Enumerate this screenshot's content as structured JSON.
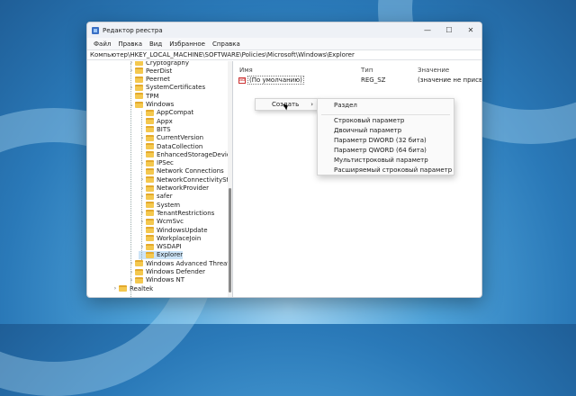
{
  "window": {
    "title": "Редактор реестра",
    "minimize": "—",
    "maximize": "☐",
    "close": "✕"
  },
  "menu": [
    "Файл",
    "Правка",
    "Вид",
    "Избранное",
    "Справка"
  ],
  "address": "Компьютер\\HKEY_LOCAL_MACHINE\\SOFTWARE\\Policies\\Microsoft\\Windows\\Explorer",
  "tree": {
    "items": [
      {
        "label": "Cryptography",
        "level": 2,
        "expanded": false,
        "has_children": true
      },
      {
        "label": "PeerDist",
        "level": 2,
        "expanded": false,
        "has_children": true
      },
      {
        "label": "Peernet",
        "level": 2,
        "expanded": false,
        "has_children": false
      },
      {
        "label": "SystemCertificates",
        "level": 2,
        "expanded": false,
        "has_children": true
      },
      {
        "label": "TPM",
        "level": 2,
        "expanded": false,
        "has_children": false
      },
      {
        "label": "Windows",
        "level": 2,
        "expanded": true,
        "has_children": true
      },
      {
        "label": "AppCompat",
        "level": 3,
        "expanded": false,
        "has_children": false
      },
      {
        "label": "Appx",
        "level": 3,
        "expanded": false,
        "has_children": false
      },
      {
        "label": "BITS",
        "level": 3,
        "expanded": false,
        "has_children": false
      },
      {
        "label": "CurrentVersion",
        "level": 3,
        "expanded": false,
        "has_children": true
      },
      {
        "label": "DataCollection",
        "level": 3,
        "expanded": false,
        "has_children": false
      },
      {
        "label": "EnhancedStorageDevices",
        "level": 3,
        "expanded": false,
        "has_children": false
      },
      {
        "label": "IPSec",
        "level": 3,
        "expanded": false,
        "has_children": true
      },
      {
        "label": "Network Connections",
        "level": 3,
        "expanded": false,
        "has_children": false
      },
      {
        "label": "NetworkConnectivityStatusInc",
        "level": 3,
        "expanded": false,
        "has_children": true
      },
      {
        "label": "NetworkProvider",
        "level": 3,
        "expanded": false,
        "has_children": true
      },
      {
        "label": "safer",
        "level": 3,
        "expanded": false,
        "has_children": true
      },
      {
        "label": "System",
        "level": 3,
        "expanded": false,
        "has_children": false
      },
      {
        "label": "TenantRestrictions",
        "level": 3,
        "expanded": false,
        "has_children": true
      },
      {
        "label": "WcmSvc",
        "level": 3,
        "expanded": false,
        "has_children": true
      },
      {
        "label": "WindowsUpdate",
        "level": 3,
        "expanded": false,
        "has_children": false
      },
      {
        "label": "WorkplaceJoin",
        "level": 3,
        "expanded": false,
        "has_children": false
      },
      {
        "label": "WSDAPI",
        "level": 3,
        "expanded": false,
        "has_children": true
      },
      {
        "label": "Explorer",
        "level": 3,
        "expanded": false,
        "has_children": false,
        "selected": true
      },
      {
        "label": "Windows Advanced Threat Prote",
        "level": 2,
        "expanded": false,
        "has_children": true
      },
      {
        "label": "Windows Defender",
        "level": 2,
        "expanded": false,
        "has_children": true
      },
      {
        "label": "Windows NT",
        "level": 2,
        "expanded": false,
        "has_children": true
      },
      {
        "label": "Realtek",
        "level": 1,
        "expanded": false,
        "has_children": true
      }
    ]
  },
  "list": {
    "headers": {
      "name": "Имя",
      "type": "Тип",
      "value": "Значение"
    },
    "rows": [
      {
        "name": "(По умолчанию)",
        "type": "REG_SZ",
        "value": "(значение не присвоено)"
      }
    ]
  },
  "context_menu": {
    "create_label": "Создать",
    "arrow": "›",
    "submenu": [
      "Раздел",
      "Строковый параметр",
      "Двоичный параметр",
      "Параметр DWORD (32 бита)",
      "Параметр QWORD (64 бита)",
      "Мультистроковый параметр",
      "Расширяемый строковый параметр"
    ]
  },
  "colors": {
    "selection": "#cce4f7",
    "folder": "#f4c84f"
  }
}
